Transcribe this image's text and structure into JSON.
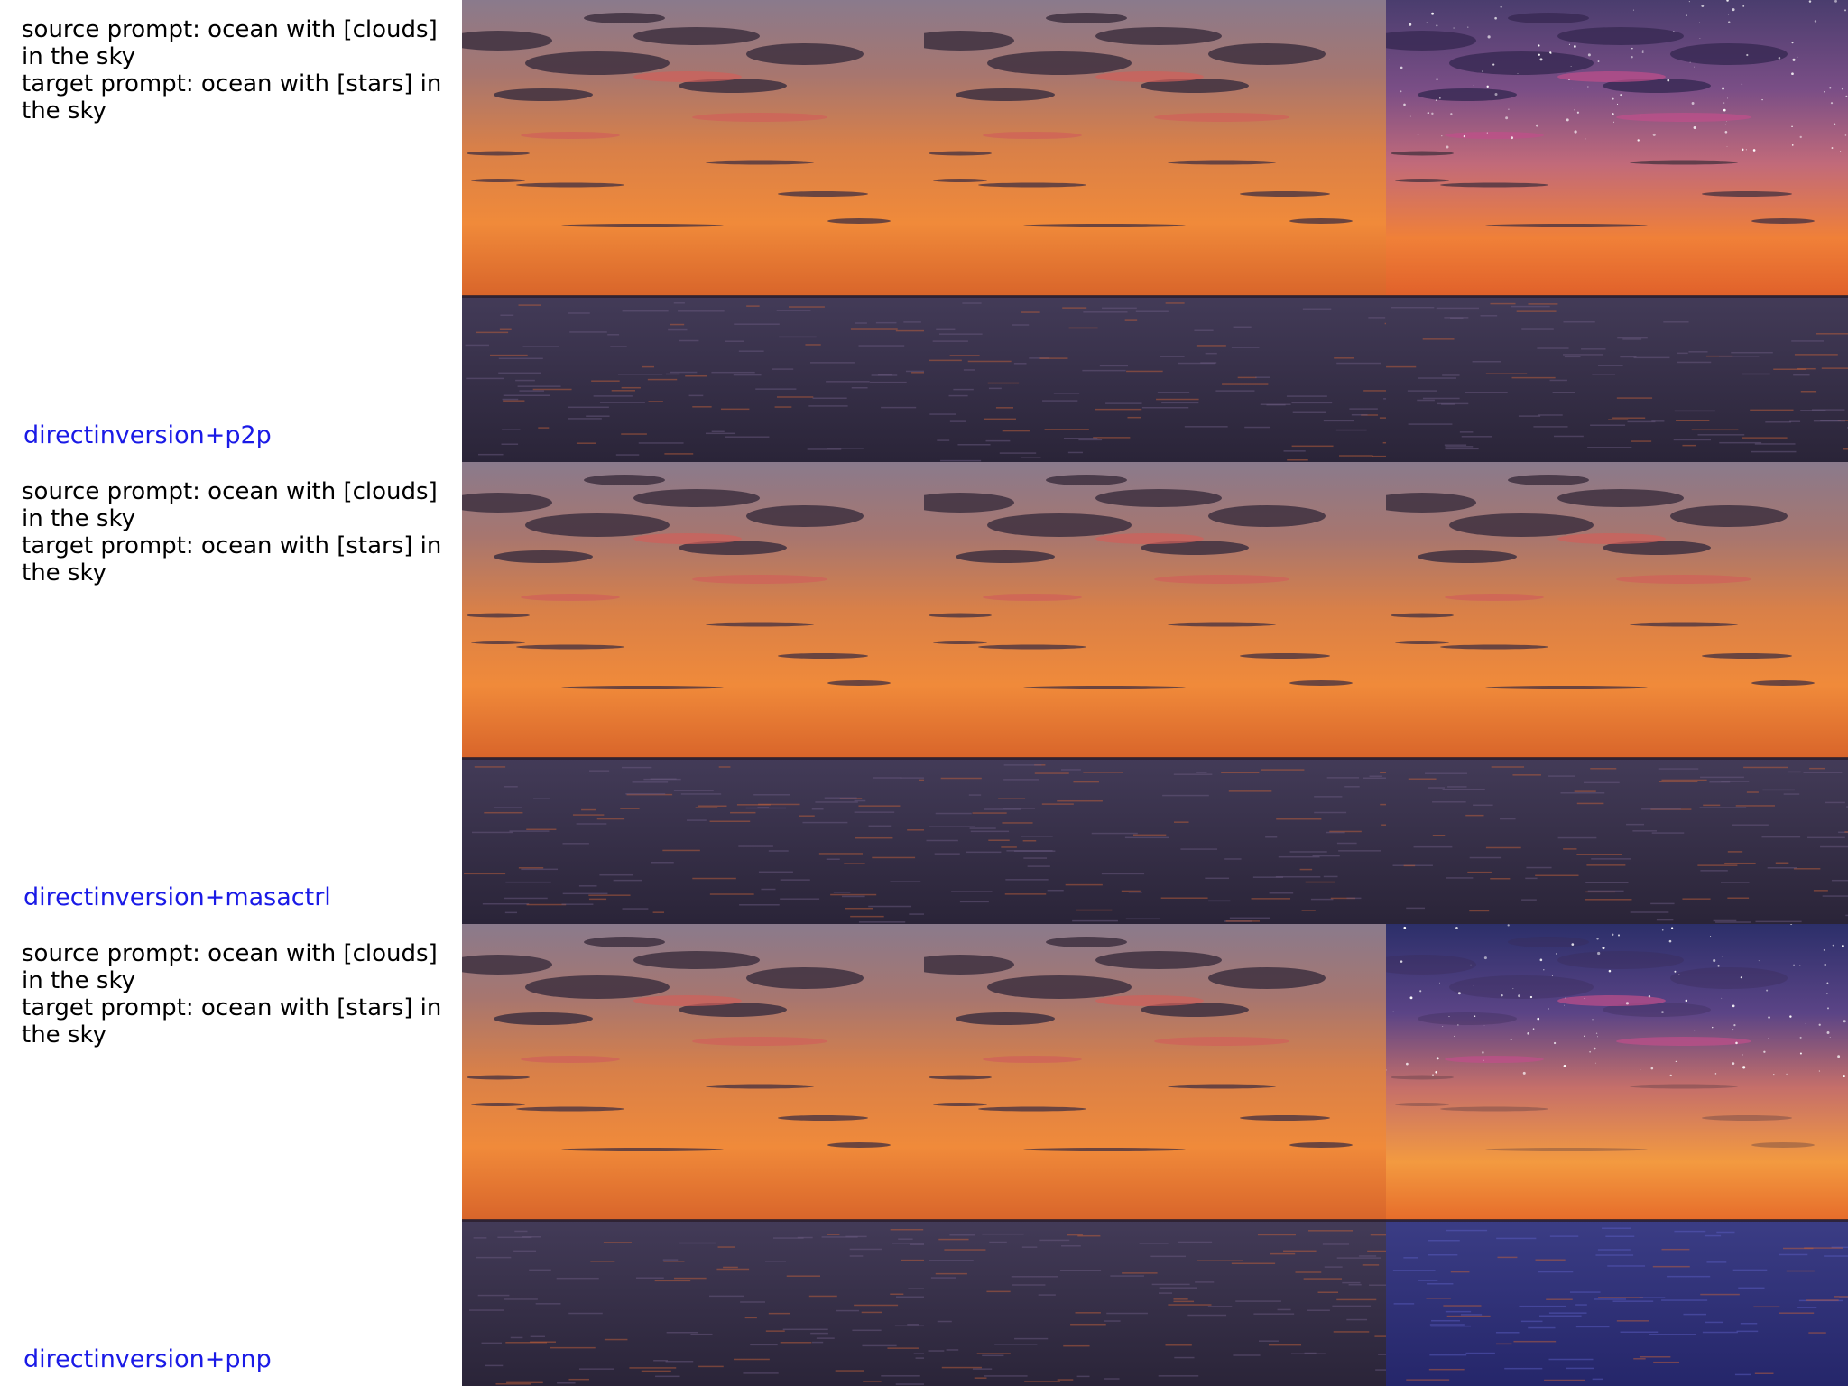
{
  "colors": {
    "method_label": "#1a1ae6",
    "prompt_text": "#000000"
  },
  "rows": [
    {
      "source_prompt": "source prompt: ocean with [clouds] in the sky",
      "target_prompt": "target prompt: ocean with [stars] in the sky",
      "method": "directinversion+p2p",
      "images": [
        {
          "variant": "source-sunset",
          "stars": false
        },
        {
          "variant": "reconstruction-sunset",
          "stars": false
        },
        {
          "variant": "edited-starry",
          "stars": true
        }
      ]
    },
    {
      "source_prompt": "source prompt: ocean with [clouds] in the sky",
      "target_prompt": "target prompt: ocean with [stars] in the sky",
      "method": "directinversion+masactrl",
      "images": [
        {
          "variant": "source-sunset",
          "stars": false
        },
        {
          "variant": "reconstruction-sunset",
          "stars": false
        },
        {
          "variant": "edited-sunset",
          "stars": false
        }
      ]
    },
    {
      "source_prompt": "source prompt: ocean with [clouds] in the sky",
      "target_prompt": "target prompt: ocean with [stars] in the sky",
      "method": "directinversion+pnp",
      "images": [
        {
          "variant": "source-sunset",
          "stars": false
        },
        {
          "variant": "reconstruction-sunset",
          "stars": false
        },
        {
          "variant": "edited-starry-blue",
          "stars": true
        }
      ]
    }
  ]
}
